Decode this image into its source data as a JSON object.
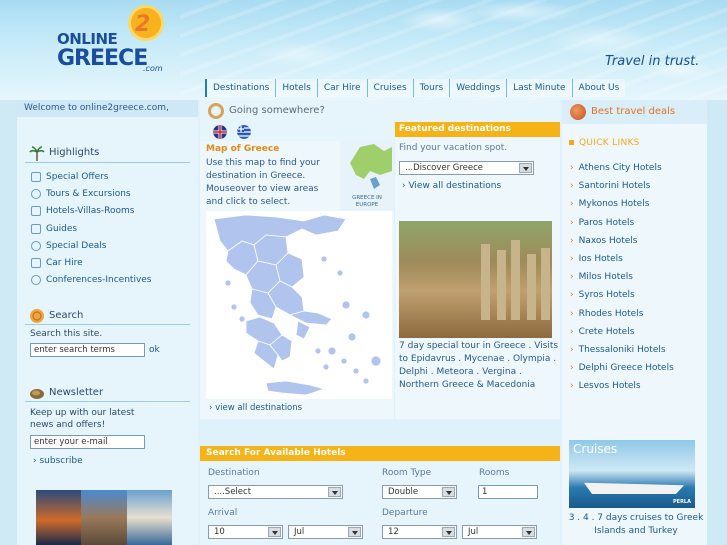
{
  "brand": {
    "line1": "ONLINE",
    "two": "2",
    "line2": "GREECE",
    "domain": ".com",
    "tagline": "Travel in trust."
  },
  "nav": [
    "Destinations",
    "Hotels",
    "Car Hire",
    "Cruises",
    "Tours",
    "Weddings",
    "Last Minute",
    "About Us"
  ],
  "left": {
    "welcome": "Welcome to online2greece.com,",
    "highlights_title": "Highlights",
    "highlights": [
      "Special Offers",
      "Tours & Excursions",
      "Hotels-Villas-Rooms",
      "Guides",
      "Special Deals",
      "Car Hire",
      "Conferences-Incentives"
    ],
    "search_title": "Search",
    "search_text": "Search this site.",
    "search_placeholder": "enter search terms",
    "search_go": "ok",
    "newsletter_title": "Newsletter",
    "newsletter_text": "Keep up with our latest news and offers!",
    "email_placeholder": "enter your e-mail",
    "subscribe": "subscribe"
  },
  "center": {
    "going": "Going somewhere?",
    "map_title": "Map of Greece",
    "map_desc": "Use this map to find your destination in Greece. Mouseover to view areas and click to select.",
    "europe_caption": "GREECE IN EUROPE",
    "view_all_map": "view all destinations",
    "featured_head": "Featured destinations",
    "featured_find": "Find your vacation spot.",
    "discover": "...Discover Greece",
    "featured_view_all": "View all destinations",
    "featured_desc": "7 day special tour in Greece . Visits to Epidavrus . Mycenae . Olympia . Delphi . Meteora . Vergina . Northern Greece & Macedonia"
  },
  "search_hotels": {
    "head": "Search For Available Hotels",
    "destination_label": "Destination",
    "destination_value": "....Select",
    "room_type_label": "Room Type",
    "room_type_value": "Double",
    "rooms_label": "Rooms",
    "rooms_value": "1",
    "arrival_label": "Arrival",
    "arrival_day": "10",
    "arrival_month": "Jul",
    "departure_label": "Departure",
    "departure_day": "12",
    "departure_month": "Jul"
  },
  "right": {
    "best": "Best travel deals",
    "quick": "QUICK LINKS",
    "links": [
      "Athens City Hotels",
      "Santorini Hotels",
      "Mykonos Hotels",
      "Paros Hotels",
      "Naxos Hotels",
      "Ios Hotels",
      "Milos Hotels",
      "Syros Hotels",
      "Rhodes Hotels",
      "Crete Hotels",
      "Thessaloniki Hotels",
      "Delphi Greece Hotels",
      "Lesvos Hotels"
    ],
    "cruise_title": "Cruises",
    "cruise_logo": "PERLA",
    "cruise_caption": "3 . 4 . 7 days cruises to Greek Islands and Turkey"
  },
  "colors": {
    "accent": "#f5b317",
    "link": "#1a5a8a",
    "brand": "#1a4e9a"
  }
}
